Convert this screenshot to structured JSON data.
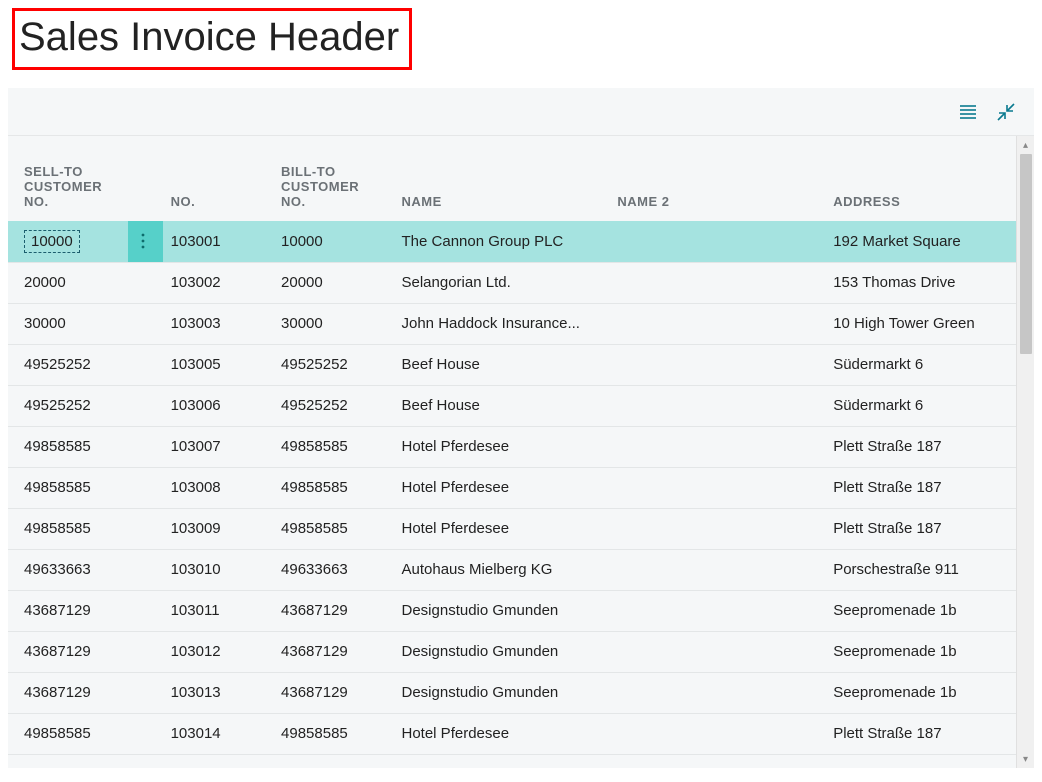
{
  "title": "Sales Invoice Header",
  "columns": {
    "sell_to": "SELL-TO CUSTOMER NO.",
    "no": "NO.",
    "bill_to": "BILL-TO CUSTOMER NO.",
    "name": "NAME",
    "name2": "NAME 2",
    "address": "ADDRESS"
  },
  "rows": [
    {
      "sell_to": "10000",
      "no": "103001",
      "bill_to": "10000",
      "name": "The Cannon Group PLC",
      "name2": "",
      "address": "192 Market Square",
      "selected": true
    },
    {
      "sell_to": "20000",
      "no": "103002",
      "bill_to": "20000",
      "name": "Selangorian Ltd.",
      "name2": "",
      "address": "153 Thomas Drive"
    },
    {
      "sell_to": "30000",
      "no": "103003",
      "bill_to": "30000",
      "name": "John Haddock Insurance...",
      "name2": "",
      "address": "10 High Tower Green"
    },
    {
      "sell_to": "49525252",
      "no": "103005",
      "bill_to": "49525252",
      "name": "Beef House",
      "name2": "",
      "address": "Südermarkt 6"
    },
    {
      "sell_to": "49525252",
      "no": "103006",
      "bill_to": "49525252",
      "name": "Beef House",
      "name2": "",
      "address": "Südermarkt 6"
    },
    {
      "sell_to": "49858585",
      "no": "103007",
      "bill_to": "49858585",
      "name": "Hotel Pferdesee",
      "name2": "",
      "address": "Plett Straße 187"
    },
    {
      "sell_to": "49858585",
      "no": "103008",
      "bill_to": "49858585",
      "name": "Hotel Pferdesee",
      "name2": "",
      "address": "Plett Straße 187"
    },
    {
      "sell_to": "49858585",
      "no": "103009",
      "bill_to": "49858585",
      "name": "Hotel Pferdesee",
      "name2": "",
      "address": "Plett Straße 187"
    },
    {
      "sell_to": "49633663",
      "no": "103010",
      "bill_to": "49633663",
      "name": "Autohaus Mielberg KG",
      "name2": "",
      "address": "Porschestraße 911"
    },
    {
      "sell_to": "43687129",
      "no": "103011",
      "bill_to": "43687129",
      "name": "Designstudio Gmunden",
      "name2": "",
      "address": "Seepromenade 1b"
    },
    {
      "sell_to": "43687129",
      "no": "103012",
      "bill_to": "43687129",
      "name": "Designstudio Gmunden",
      "name2": "",
      "address": "Seepromenade 1b"
    },
    {
      "sell_to": "43687129",
      "no": "103013",
      "bill_to": "43687129",
      "name": "Designstudio Gmunden",
      "name2": "",
      "address": "Seepromenade 1b"
    },
    {
      "sell_to": "49858585",
      "no": "103014",
      "bill_to": "49858585",
      "name": "Hotel Pferdesee",
      "name2": "",
      "address": "Plett Straße 187"
    }
  ]
}
